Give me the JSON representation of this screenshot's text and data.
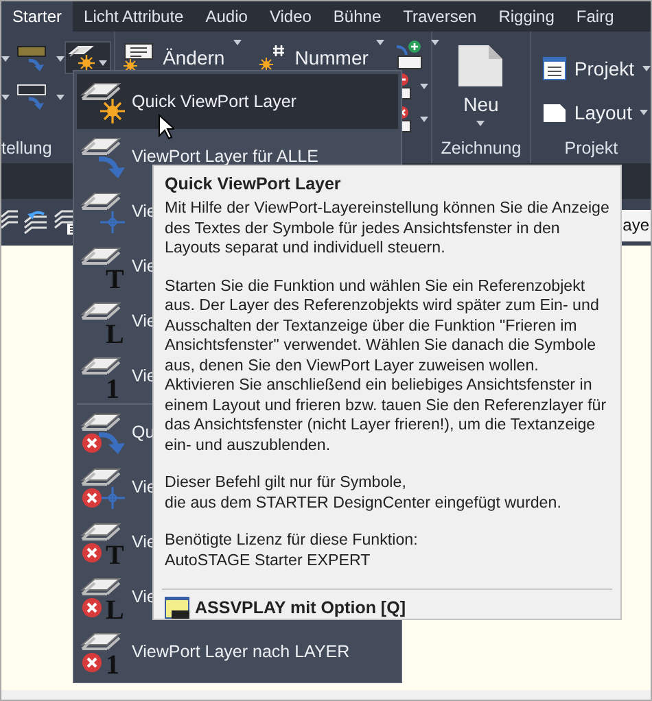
{
  "tabs": [
    {
      "label": "Starter",
      "selected": true
    },
    {
      "label": "Licht Attribute",
      "selected": false
    },
    {
      "label": "Audio",
      "selected": false
    },
    {
      "label": "Video",
      "selected": false
    },
    {
      "label": "Bühne",
      "selected": false
    },
    {
      "label": "Traversen",
      "selected": false
    },
    {
      "label": "Rigging",
      "selected": false
    },
    {
      "label": "Fairg",
      "selected": false
    }
  ],
  "ribbon": {
    "edit_button": "Ändern",
    "number_button": "Nummer",
    "new_button": "Neu",
    "project_button": "Projekt",
    "layout_button": "Layout",
    "panel_labels": [
      "tellung",
      "Zeichnung",
      "Projekt"
    ]
  },
  "toolbar": {
    "tab_text": "aye"
  },
  "menu": {
    "groups": [
      [
        {
          "label": "Quick ViewPort Layer",
          "kind": "sun",
          "removed": false,
          "selected": true
        },
        {
          "label": "ViewPort Layer für ALLE",
          "kind": "arrow",
          "removed": false,
          "selected": false
        },
        {
          "label": "Vie",
          "kind": "crosshair",
          "removed": false,
          "selected": false
        },
        {
          "label": "Vie",
          "kind": "letter",
          "glyph": "T",
          "removed": false,
          "selected": false
        },
        {
          "label": "Vie",
          "kind": "letter",
          "glyph": "L",
          "removed": false,
          "selected": false
        },
        {
          "label": "Vie",
          "kind": "letter",
          "glyph": "1",
          "removed": false,
          "selected": false
        }
      ],
      [
        {
          "label": "Qu",
          "kind": "arrow",
          "removed": true,
          "selected": false
        },
        {
          "label": "Vie",
          "kind": "crosshair",
          "removed": true,
          "selected": false
        },
        {
          "label": "Vie",
          "kind": "letter",
          "glyph": "T",
          "removed": true,
          "selected": false
        },
        {
          "label": "Vie",
          "kind": "letter",
          "glyph": "L",
          "removed": true,
          "selected": false
        },
        {
          "label": "ViewPort Layer nach LAYER",
          "kind": "letter",
          "glyph": "1",
          "removed": true,
          "selected": false
        }
      ]
    ]
  },
  "tooltip": {
    "title": "Quick ViewPort Layer",
    "paragraphs": [
      "Mit Hilfe der ViewPort-Layereinstellung können Sie die Anzeige des Textes der Symbole für jedes Ansichtsfenster in den Layouts separat und individuell steuern.",
      "Starten Sie die Funktion und wählen Sie ein Referenzobjekt aus. Der Layer des Referenzobjekts wird später zum Ein- und Ausschalten der Textanzeige über die Funktion \"Frieren im Ansichtsfenster\" verwendet. Wählen Sie danach die Symbole aus, denen Sie den ViewPort Layer zuweisen wollen. Aktivieren Sie anschließend ein beliebiges Ansichtsfenster in einem Layout und frieren bzw. tauen Sie den Referenzlayer für das Ansichtsfenster (nicht Layer frieren!), um die Textanzeige ein- und auszublenden.",
      "Dieser Befehl gilt nur für Symbole,\ndie aus dem STARTER DesignCenter eingefügt wurden.",
      "Benötigte Lizenz für diese Funktion:\nAutoSTAGE Starter EXPERT"
    ],
    "footer": "ASSVPLAY mit Option [Q]"
  }
}
